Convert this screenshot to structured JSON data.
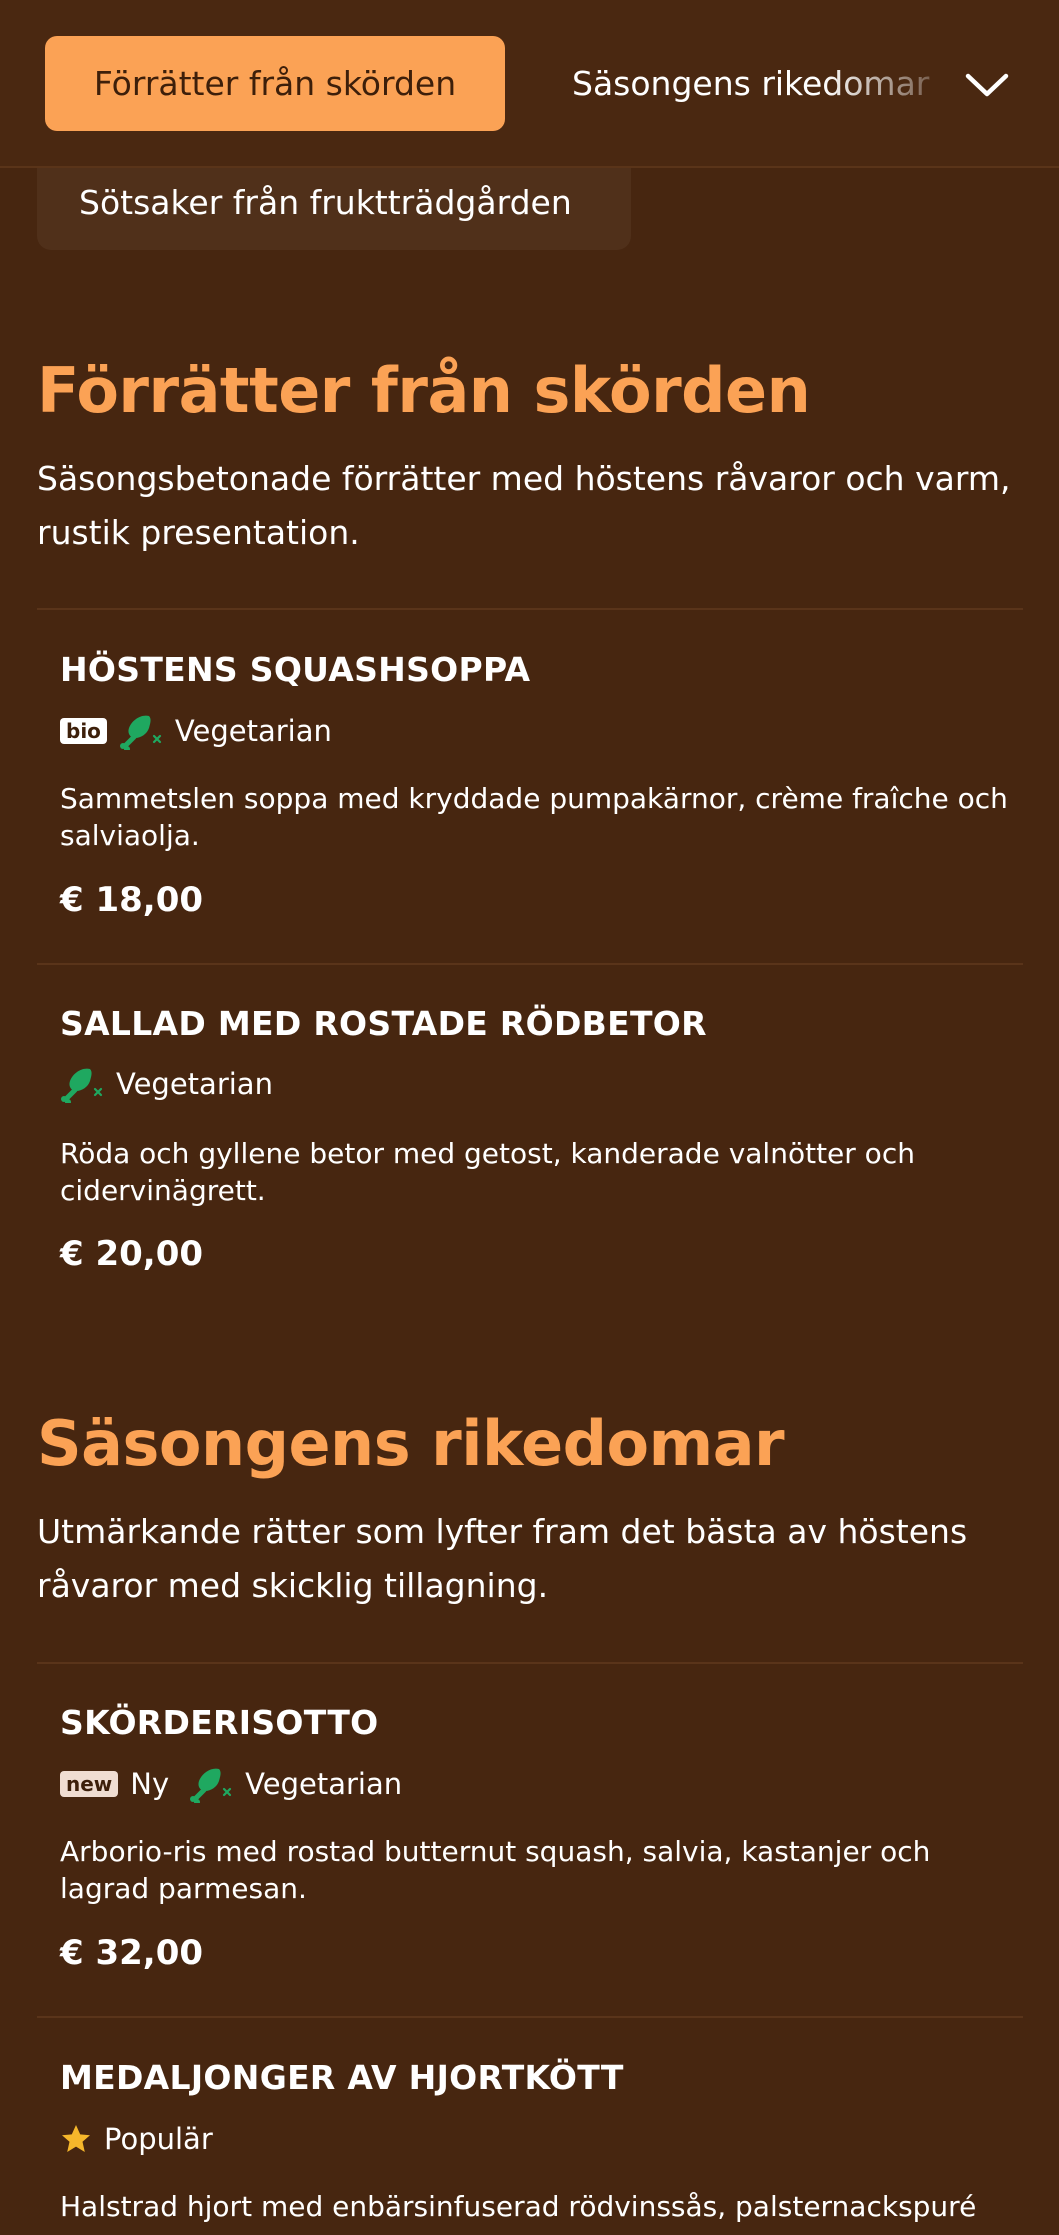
{
  "nav": {
    "active_label": "Förrätter från skörden",
    "second_label": "Säsongens rikedomar",
    "third_label": "Sötsaker från fruktträdgården"
  },
  "sections": [
    {
      "title": "Förrätter från skörden",
      "description": "Säsongsbetonade förrätter med höstens råvaror och varm, rustik presentation.",
      "items": [
        {
          "name": "HÖSTENS SQUASHSOPPA",
          "badge": "bio",
          "tag": "Vegetarian",
          "description": "Sammetslen soppa med kryddade pumpakärnor, crème fraîche och salviaolja.",
          "price": "€ 18,00"
        },
        {
          "name": "SALLAD MED ROSTADE RÖDBETOR",
          "tag": "Vegetarian",
          "description": "Röda och gyllene betor med getost, kanderade valnötter och cidervinägrett.",
          "price": "€ 20,00"
        }
      ]
    },
    {
      "title": "Säsongens rikedomar",
      "description": "Utmärkande rätter som lyfter fram det bästa av höstens råvaror med skicklig tillagning.",
      "items": [
        {
          "name": "SKÖRDERISOTTO",
          "badge": "new",
          "badge_label": "Ny",
          "tag": "Vegetarian",
          "description": "Arborio-ris med rostad butternut squash, salvia, kastanjer och lagrad parmesan.",
          "price": "€ 32,00"
        },
        {
          "name": "MEDALJONGER AV HJORTKÖTT",
          "tag": "Populär",
          "description": "Halstrad hjort med enbärsinfuserad rödvinssås, palsternackspuré"
        }
      ]
    }
  ],
  "icons": {
    "vegetarian": "no-meat-icon",
    "popular": "star-icon",
    "nav": "chevron-down-icon"
  },
  "colors": {
    "background": "#472610",
    "accent": "#fba255",
    "vegetarian_green": "#1fa860",
    "star": "#f6b72b"
  }
}
